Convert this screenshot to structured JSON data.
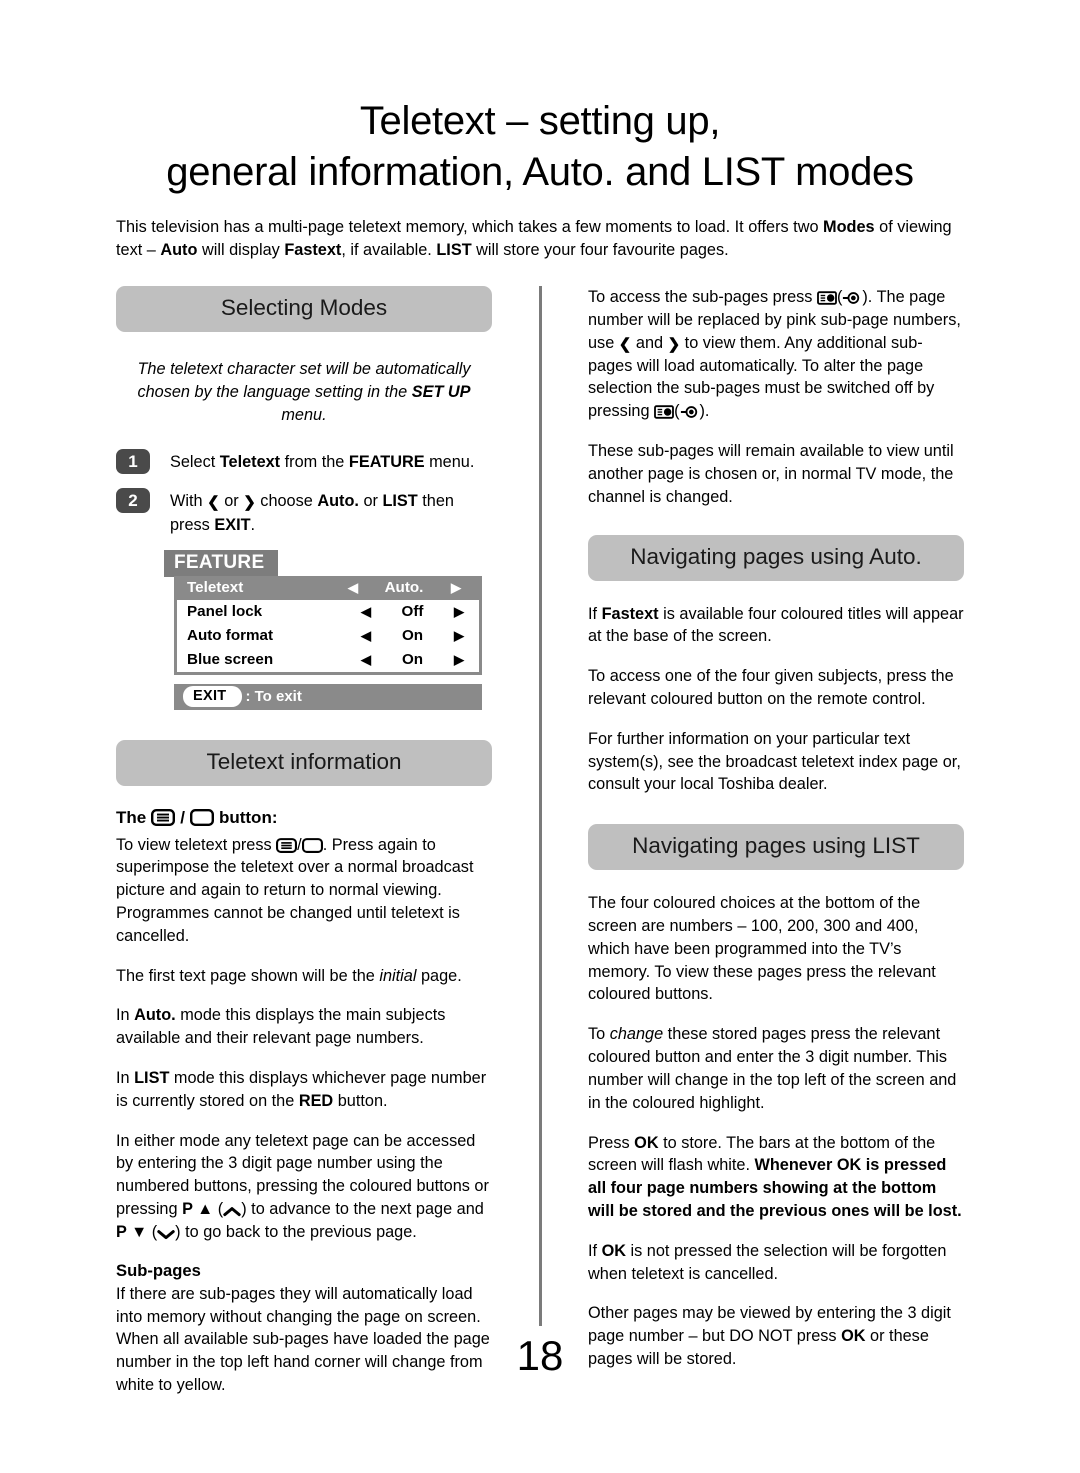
{
  "document": {
    "title_line1": "Teletext – setting up,",
    "title_line2": "general information, Auto. and LIST modes",
    "page_number": "18"
  },
  "intro": {
    "text": "This television has a multi-page teletext memory, which takes a few moments to load. It offers two Modes of viewing text – Auto will display Fastext, if available. LIST will store your four favourite pages.",
    "bold_terms": [
      "Modes",
      "Auto",
      "Fastext",
      "LIST"
    ]
  },
  "left_column": {
    "section_selecting_modes": {
      "banner": "Selecting Modes",
      "note": "The teletext character set will be automatically chosen by the language setting in the SET UP menu.",
      "note_bold": "SET UP",
      "steps": [
        {
          "number": "1",
          "text": "Select Teletext from the FEATURE menu."
        },
        {
          "number": "2",
          "text": "With ❮ or ❯ choose Auto. or LIST then press EXIT."
        }
      ]
    },
    "osd": {
      "tab_label": "FEATURE",
      "rows": [
        {
          "label": "Teletext",
          "value": "Auto.",
          "selected": true
        },
        {
          "label": "Panel lock",
          "value": "Off",
          "selected": false
        },
        {
          "label": "Auto format",
          "value": "On",
          "selected": false
        },
        {
          "label": "Blue screen",
          "value": "On",
          "selected": false
        }
      ],
      "exit_button_label": "EXIT",
      "exit_hint": ": To exit"
    },
    "section_teletext_information": {
      "banner": "Teletext information",
      "button_heading_prefix": "The",
      "button_heading_suffix": "button:",
      "paragraphs": [
        "To view teletext press [TEXT]/[BLANK]. Press again to superimpose the teletext over a normal broadcast picture and again to return to normal viewing. Programmes cannot be changed until teletext is cancelled.",
        "The first text page shown will be the initial page.",
        "In Auto. mode this displays the main subjects available and their relevant page numbers.",
        "In LIST mode this displays whichever page number is currently stored on the RED button.",
        "In either mode any teletext page can be accessed by entering the 3 digit page number using the numbered buttons, pressing the coloured buttons or pressing P ▲ (∧) to advance to the next page and P ▼ (∨) to go back to the previous page."
      ],
      "sub_pages_heading": "Sub-pages",
      "sub_pages_text": "If there are sub-pages they will automatically load into memory without changing the page on screen. When all available sub-pages have loaded the page number in the top left hand corner will change from white to yellow."
    }
  },
  "right_column": {
    "intro_paragraphs": [
      "To access the sub-pages press [HOLD]([REVEAL]). The page number will be replaced by pink sub-page numbers, use ❮ and ❯ to view them. Any additional sub-pages will load automatically. To alter the page selection the sub-pages must be switched off by pressing [HOLD]([REVEAL]).",
      "These sub-pages will remain available to view until another page is chosen or, in normal TV mode, the channel is changed."
    ],
    "section_auto": {
      "banner": "Navigating pages using Auto.",
      "paragraphs": [
        "If Fastext is available four coloured titles will appear at the base of the screen.",
        "To access one of the four given subjects, press the relevant coloured button on the remote control.",
        "For further information on your particular text system(s), see the broadcast teletext index page or, consult your local Toshiba dealer."
      ]
    },
    "section_list": {
      "banner": "Navigating pages using LIST",
      "paragraphs": [
        "The four coloured choices at the bottom of the screen are numbers – 100, 200, 300 and 400, which have been programmed into the TV’s memory. To view these pages press the relevant coloured buttons.",
        "To change these stored pages press the relevant coloured button and enter the 3 digit number. This number will change in the top left of the screen and in the coloured highlight.",
        "Press OK to store. The bars at the bottom of the screen will flash white. Whenever OK is pressed all four page numbers showing at the bottom will be stored and the previous ones will be lost.",
        "If OK is not pressed the selection will be forgotten when teletext is cancelled.",
        "Other pages may be viewed by entering the 3 digit page number – but DO NOT press OK or these pages will be stored."
      ]
    }
  },
  "colors": {
    "banner_background": "#bfbfbf",
    "osd_gray": "#8a8a8a",
    "osd_tab_gray": "#7d7d7d",
    "step_badge": "#4a4a4a",
    "divider": "#7b7b7b",
    "text": "#000000"
  },
  "icons": {
    "text_button": "teletext-menu-icon",
    "blank_button": "blank-screen-icon",
    "hold_button": "subpage-hold-icon",
    "reveal_button": "subpage-reveal-icon",
    "left_chevron": "❮",
    "right_chevron": "❯",
    "up_triangle": "▲",
    "down_triangle": "▼"
  }
}
